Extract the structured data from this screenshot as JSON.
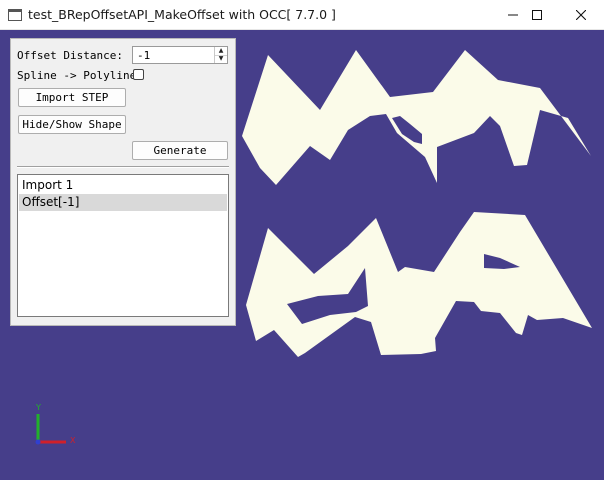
{
  "window": {
    "title": "test_BRepOffsetAPI_MakeOffset with OCC[ 7.7.0 ]",
    "icon": "app-window-icon",
    "controls": [
      "minimize-icon",
      "maximize-icon",
      "close-icon"
    ]
  },
  "panel": {
    "offset_label": "Offset Distance:",
    "offset_value": "-1",
    "spline_label": "Spline -> Polyline",
    "spline_checked": false,
    "import_button": "Import STEP",
    "toggle_button": "Hide/Show Shape",
    "generate_button": "Generate",
    "list_items": [
      {
        "label": "Import 1",
        "selected": false
      },
      {
        "label": "Offset[-1]",
        "selected": true
      }
    ]
  },
  "viewport": {
    "background": "#463e8a",
    "shape_fill": "#fbfbe9",
    "axes": {
      "x_label": "X",
      "y_label": "Y"
    }
  },
  "colors": {
    "axis_x": "#d0202a",
    "axis_y": "#22b02c",
    "axis_z": "#3040d0"
  }
}
